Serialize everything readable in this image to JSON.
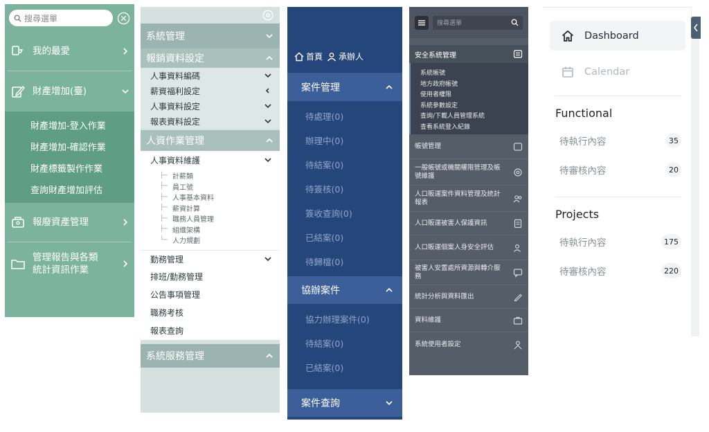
{
  "panel1": {
    "search_placeholder": "搜尋選單",
    "items": [
      {
        "label": "我的最愛",
        "icon": "favorites-icon"
      },
      {
        "label": "財產增加(臺)",
        "icon": "edit-icon",
        "expanded": true,
        "children": [
          "財產增加-登入作業",
          "財產增加-確認作業",
          "財產標籤製作作業",
          "查詢財產增加評估"
        ]
      },
      {
        "label": "報廢資產管理",
        "icon": "asset-icon"
      },
      {
        "label": "管理報告與各類\n統計資訊作業",
        "icon": "folder-icon"
      }
    ],
    "colors": {
      "bg": "#7cb39f",
      "sub_bg": "#5f9d86"
    }
  },
  "panel2": {
    "sections": [
      {
        "label": "系統管理",
        "state": "collapsed"
      },
      {
        "label": "報銷資料設定",
        "state": "expanded",
        "children": [
          "人事資料編碼",
          "薪資福利設定",
          "人事資料設定",
          "報表資料設定"
        ]
      },
      {
        "label": "人資作業管理",
        "state": "expanded"
      }
    ],
    "hr_group": "人事資料維護",
    "tree_leaves": [
      "計薪類",
      "員工號",
      "人事基本資料",
      "薪資計算",
      "職務人員管理",
      "組織架構",
      "人力規劃"
    ],
    "plain_items": [
      {
        "label": "勤務管理",
        "chevron": true
      },
      {
        "label": "排班/勤務管理",
        "chevron": false
      },
      {
        "label": "公告事項管理",
        "chevron": false
      },
      {
        "label": "職務考核",
        "chevron": false
      },
      {
        "label": "報表查詢",
        "chevron": false
      }
    ],
    "last_section": "系統服務管理"
  },
  "panel3": {
    "user_items": [
      "首頁",
      "承辦人"
    ],
    "sections": [
      {
        "label": "案件管理",
        "children": [
          "待處理(0)",
          "辦理中(0)",
          "待結案(0)",
          "待簽核(0)",
          "簽收查詢(0)",
          "已結案(0)",
          "待歸檔(0)"
        ]
      },
      {
        "label": "協辦案件",
        "children": [
          "協力辦理案件(0)",
          "待結案(0)",
          "已結案(0)"
        ]
      },
      {
        "label": "案件查詢",
        "children": []
      }
    ]
  },
  "panel4": {
    "search_placeholder": "搜尋選單",
    "group_title": "安全系統管理",
    "group_children": [
      "系統帳號",
      "地方政府帳號",
      "使用者權限",
      "系統參數設定",
      "查詢/下載人員管理系統",
      "查看系統登入紀錄"
    ],
    "rows": [
      {
        "label": "帳號管理",
        "icon": "account-icon"
      },
      {
        "label": "一般帳號或機關權限管理及帳號維護",
        "icon": "gear-icon"
      },
      {
        "label": "人口販運案件資料管理及統計報表",
        "icon": "users-icon"
      },
      {
        "label": "人口販運被害人保護資訊",
        "icon": "doc-icon"
      },
      {
        "label": "人口販運個案人身安全評估",
        "icon": "person-icon"
      },
      {
        "label": "被害人安置處所資源與轉介服務",
        "icon": "chat-icon"
      },
      {
        "label": "統計分析與資料匯出",
        "icon": "pen-icon"
      },
      {
        "label": "資料維護",
        "icon": "briefcase-icon"
      },
      {
        "label": "系統使用者設定",
        "icon": "person2-icon"
      }
    ]
  },
  "panel5": {
    "nav": [
      {
        "label": "Dashboard",
        "icon": "home-icon",
        "active": true
      },
      {
        "label": "Calendar",
        "icon": "calendar-icon",
        "active": false
      }
    ],
    "groups": [
      {
        "title": "Functional",
        "items": [
          {
            "label": "待執行內容",
            "count": "35"
          },
          {
            "label": "待審核內容",
            "count": "20"
          }
        ]
      },
      {
        "title": "Projects",
        "items": [
          {
            "label": "待執行內容",
            "count": "175"
          },
          {
            "label": "待審核內容",
            "count": "220"
          }
        ]
      }
    ]
  }
}
